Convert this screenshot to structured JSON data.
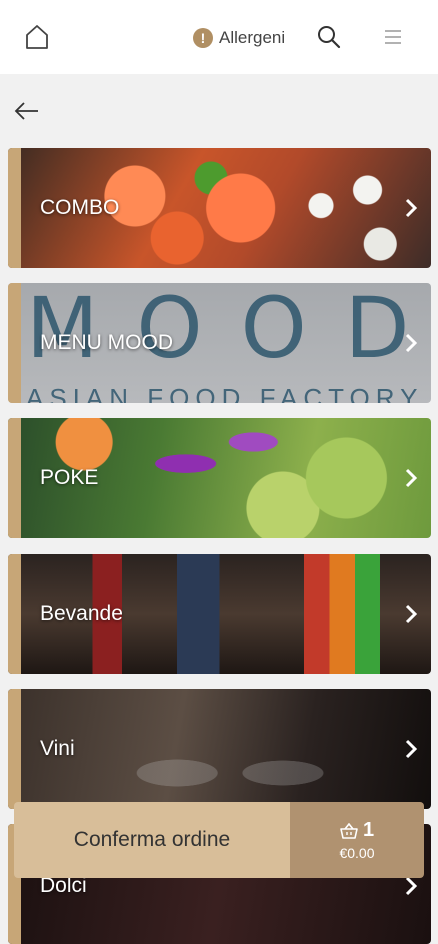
{
  "header": {
    "allergen_label": "Allergeni",
    "allergen_icon_glyph": "!"
  },
  "categories": [
    {
      "label": "COMBO"
    },
    {
      "label": "MENU MOOD",
      "image_text_main": "MOOD",
      "image_text_sub": "ASIAN FOOD FACTORY"
    },
    {
      "label": "POKE"
    },
    {
      "label": "Bevande"
    },
    {
      "label": "Vini"
    },
    {
      "label": "Dolci"
    }
  ],
  "order": {
    "confirm_label": "Conferma ordine",
    "cart_count": "1",
    "cart_total": "€0.00"
  },
  "colors": {
    "accent_gold": "#c7a677",
    "order_light": "#d8be99",
    "order_dark": "#b09270",
    "allergen": "#b08f63"
  },
  "icons": [
    "home-icon",
    "alert-icon",
    "search-icon",
    "hamburger-menu-icon",
    "back-arrow-icon",
    "chevron-right-icon",
    "basket-icon"
  ]
}
